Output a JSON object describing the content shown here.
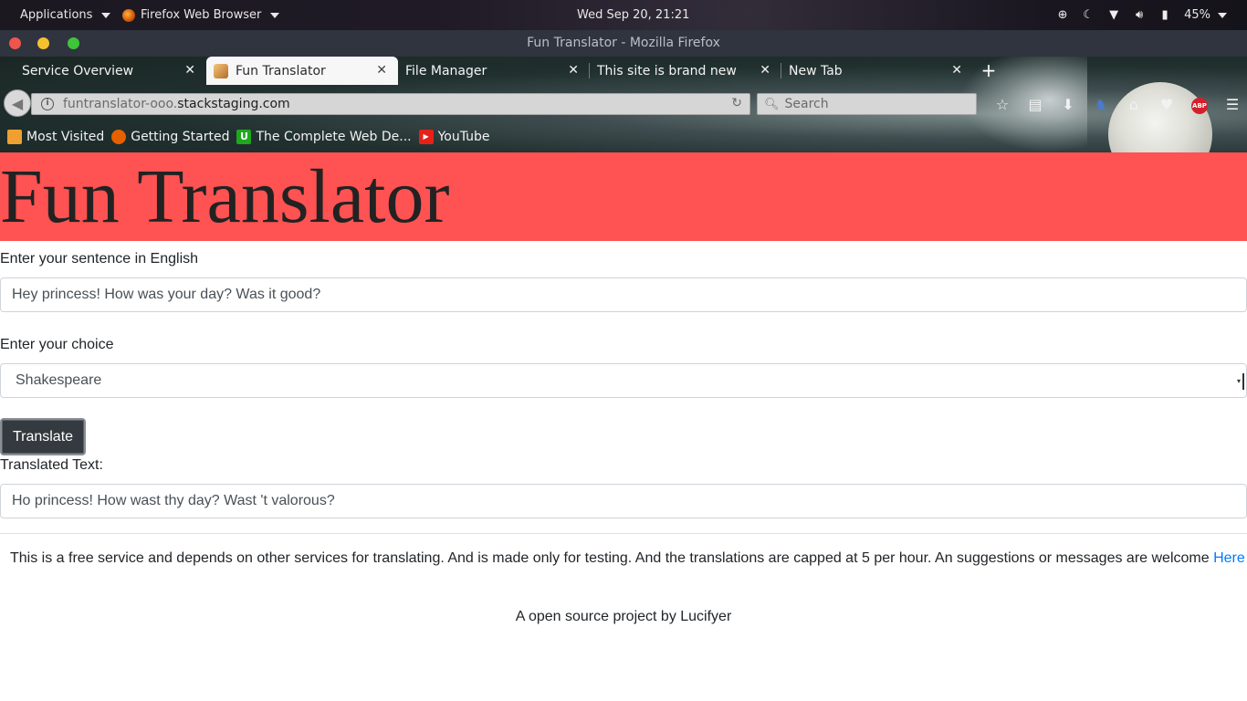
{
  "topbar": {
    "applications": "Applications",
    "active_app": "Firefox Web Browser",
    "clock": "Wed Sep 20, 21:21",
    "battery": "45%"
  },
  "window": {
    "title": "Fun Translator - Mozilla Firefox"
  },
  "tabs": [
    {
      "label": "Service Overview"
    },
    {
      "label": "Fun Translator"
    },
    {
      "label": "File Manager"
    },
    {
      "label": "This site is brand new"
    },
    {
      "label": "New Tab"
    }
  ],
  "nav": {
    "url_prefix": "funtranslator-ooo.",
    "url_domain": "stackstaging.com",
    "search_placeholder": "Search"
  },
  "bookmarks": [
    {
      "label": "Most Visited",
      "color": "#f0a030"
    },
    {
      "label": "Getting Started",
      "color": "#e66000"
    },
    {
      "label": "The Complete Web De...",
      "color": "#1ea81e"
    },
    {
      "label": "YouTube",
      "color": "#e62117"
    }
  ],
  "page": {
    "heading": "Fun Translator",
    "heading_bg": "#ff5252",
    "input_label": "Enter your sentence in English",
    "input_value": "Hey princess! How was your day? Was it good?",
    "choice_label": "Enter your choice",
    "choice_value": "Shakespeare",
    "button_label": "Translate",
    "output_label": "Translated Text:",
    "output_value": "Ho princess! How wast thy day? Wast 't valorous?",
    "footnote": "This is a free service and depends on other services for translating. And is made only for testing. And the translations are capped at 5 per hour. An suggestions or messages are welcome",
    "footnote_link": "Here",
    "credit": "A open source project by Lucifyer"
  }
}
